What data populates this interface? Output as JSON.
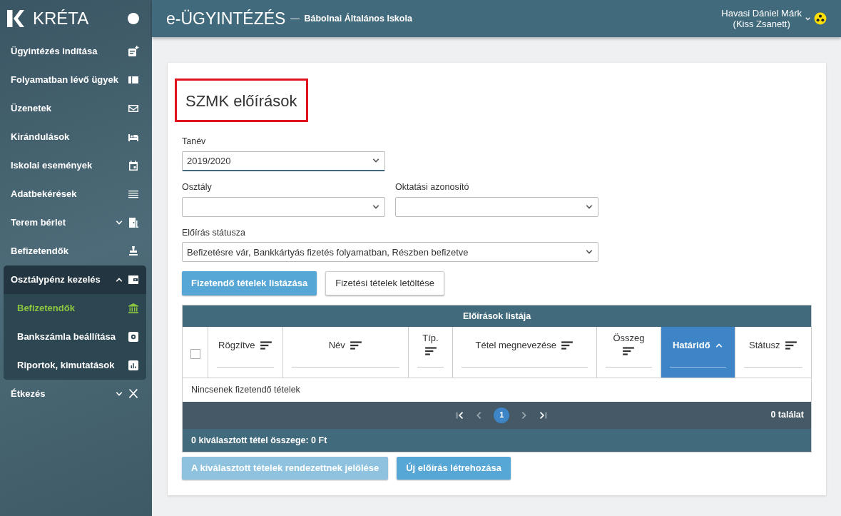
{
  "sidebar": {
    "logo_text": "KRÉTA",
    "items": [
      {
        "label": "Ügyintézés indítása",
        "kind": "link"
      },
      {
        "label": "Folyamatban lévő ügyek",
        "kind": "link"
      },
      {
        "label": "Üzenetek",
        "kind": "link"
      },
      {
        "label": "Kirándulások",
        "kind": "link"
      },
      {
        "label": "Iskolai események",
        "kind": "link"
      },
      {
        "label": "Adatbekérések",
        "kind": "link"
      },
      {
        "label": "Terem bérlet",
        "kind": "group",
        "expanded": false
      },
      {
        "label": "Befizetendők",
        "kind": "link"
      },
      {
        "label": "Osztálypénz kezelés",
        "kind": "group",
        "expanded": true,
        "children": [
          {
            "label": "Befizetendők",
            "selected": true
          },
          {
            "label": "Bankszámla beállítása",
            "selected": false
          },
          {
            "label": "Riportok, kimutatások",
            "selected": false
          }
        ]
      },
      {
        "label": "Étkezés",
        "kind": "group",
        "expanded": false
      }
    ]
  },
  "header": {
    "title": "e-ÜGYINTÉZÉS",
    "separator": "—",
    "school": "Bábolnai Általános Iskola",
    "user_name": "Havasi Dániel Márk",
    "user_sub": "(Kiss Zsanett)"
  },
  "page": {
    "title": "SZMK előírások",
    "fields": [
      {
        "label": "Tanév",
        "value": "2019/2020",
        "focused": true
      },
      {
        "label": "Osztály",
        "focused": false
      },
      {
        "label": "Oktatási azonosító",
        "focused": false
      },
      {
        "label": "Előírás státusza",
        "value": "Befizetésre vár, Bankkártyás fizetés folyamatban, Részben befizetve",
        "focused": false
      }
    ],
    "buttons": [
      {
        "label": "Fizetendő tételek listázása",
        "kind": "primary"
      },
      {
        "label": "Fizetési tételek letöltése",
        "kind": "secondary"
      }
    ],
    "table": {
      "title": "Előírások listája",
      "select_all_checked": false,
      "columns": [
        {
          "label": "Rögzítve",
          "selected": false
        },
        {
          "label": "Név",
          "selected": false
        },
        {
          "label": "Típ.",
          "selected": false
        },
        {
          "label": "Tétel megnevezése",
          "selected": false
        },
        {
          "label": "Összeg",
          "selected": false
        },
        {
          "label": "Határidő",
          "selected": true
        },
        {
          "label": "Státusz",
          "selected": false
        }
      ],
      "empty_text": "Nincsenek fizetendő tételek",
      "pages": [
        {
          "label": "1",
          "selected": true
        }
      ],
      "result_count": "0 találat",
      "summary": "0 kiválasztott tétel összege: 0 Ft"
    },
    "bottom_buttons": [
      {
        "label": "A kiválasztott tételek rendezettnek jelölése",
        "disabled": true
      },
      {
        "label": "Új előírás létrehozása",
        "disabled": false
      }
    ]
  }
}
